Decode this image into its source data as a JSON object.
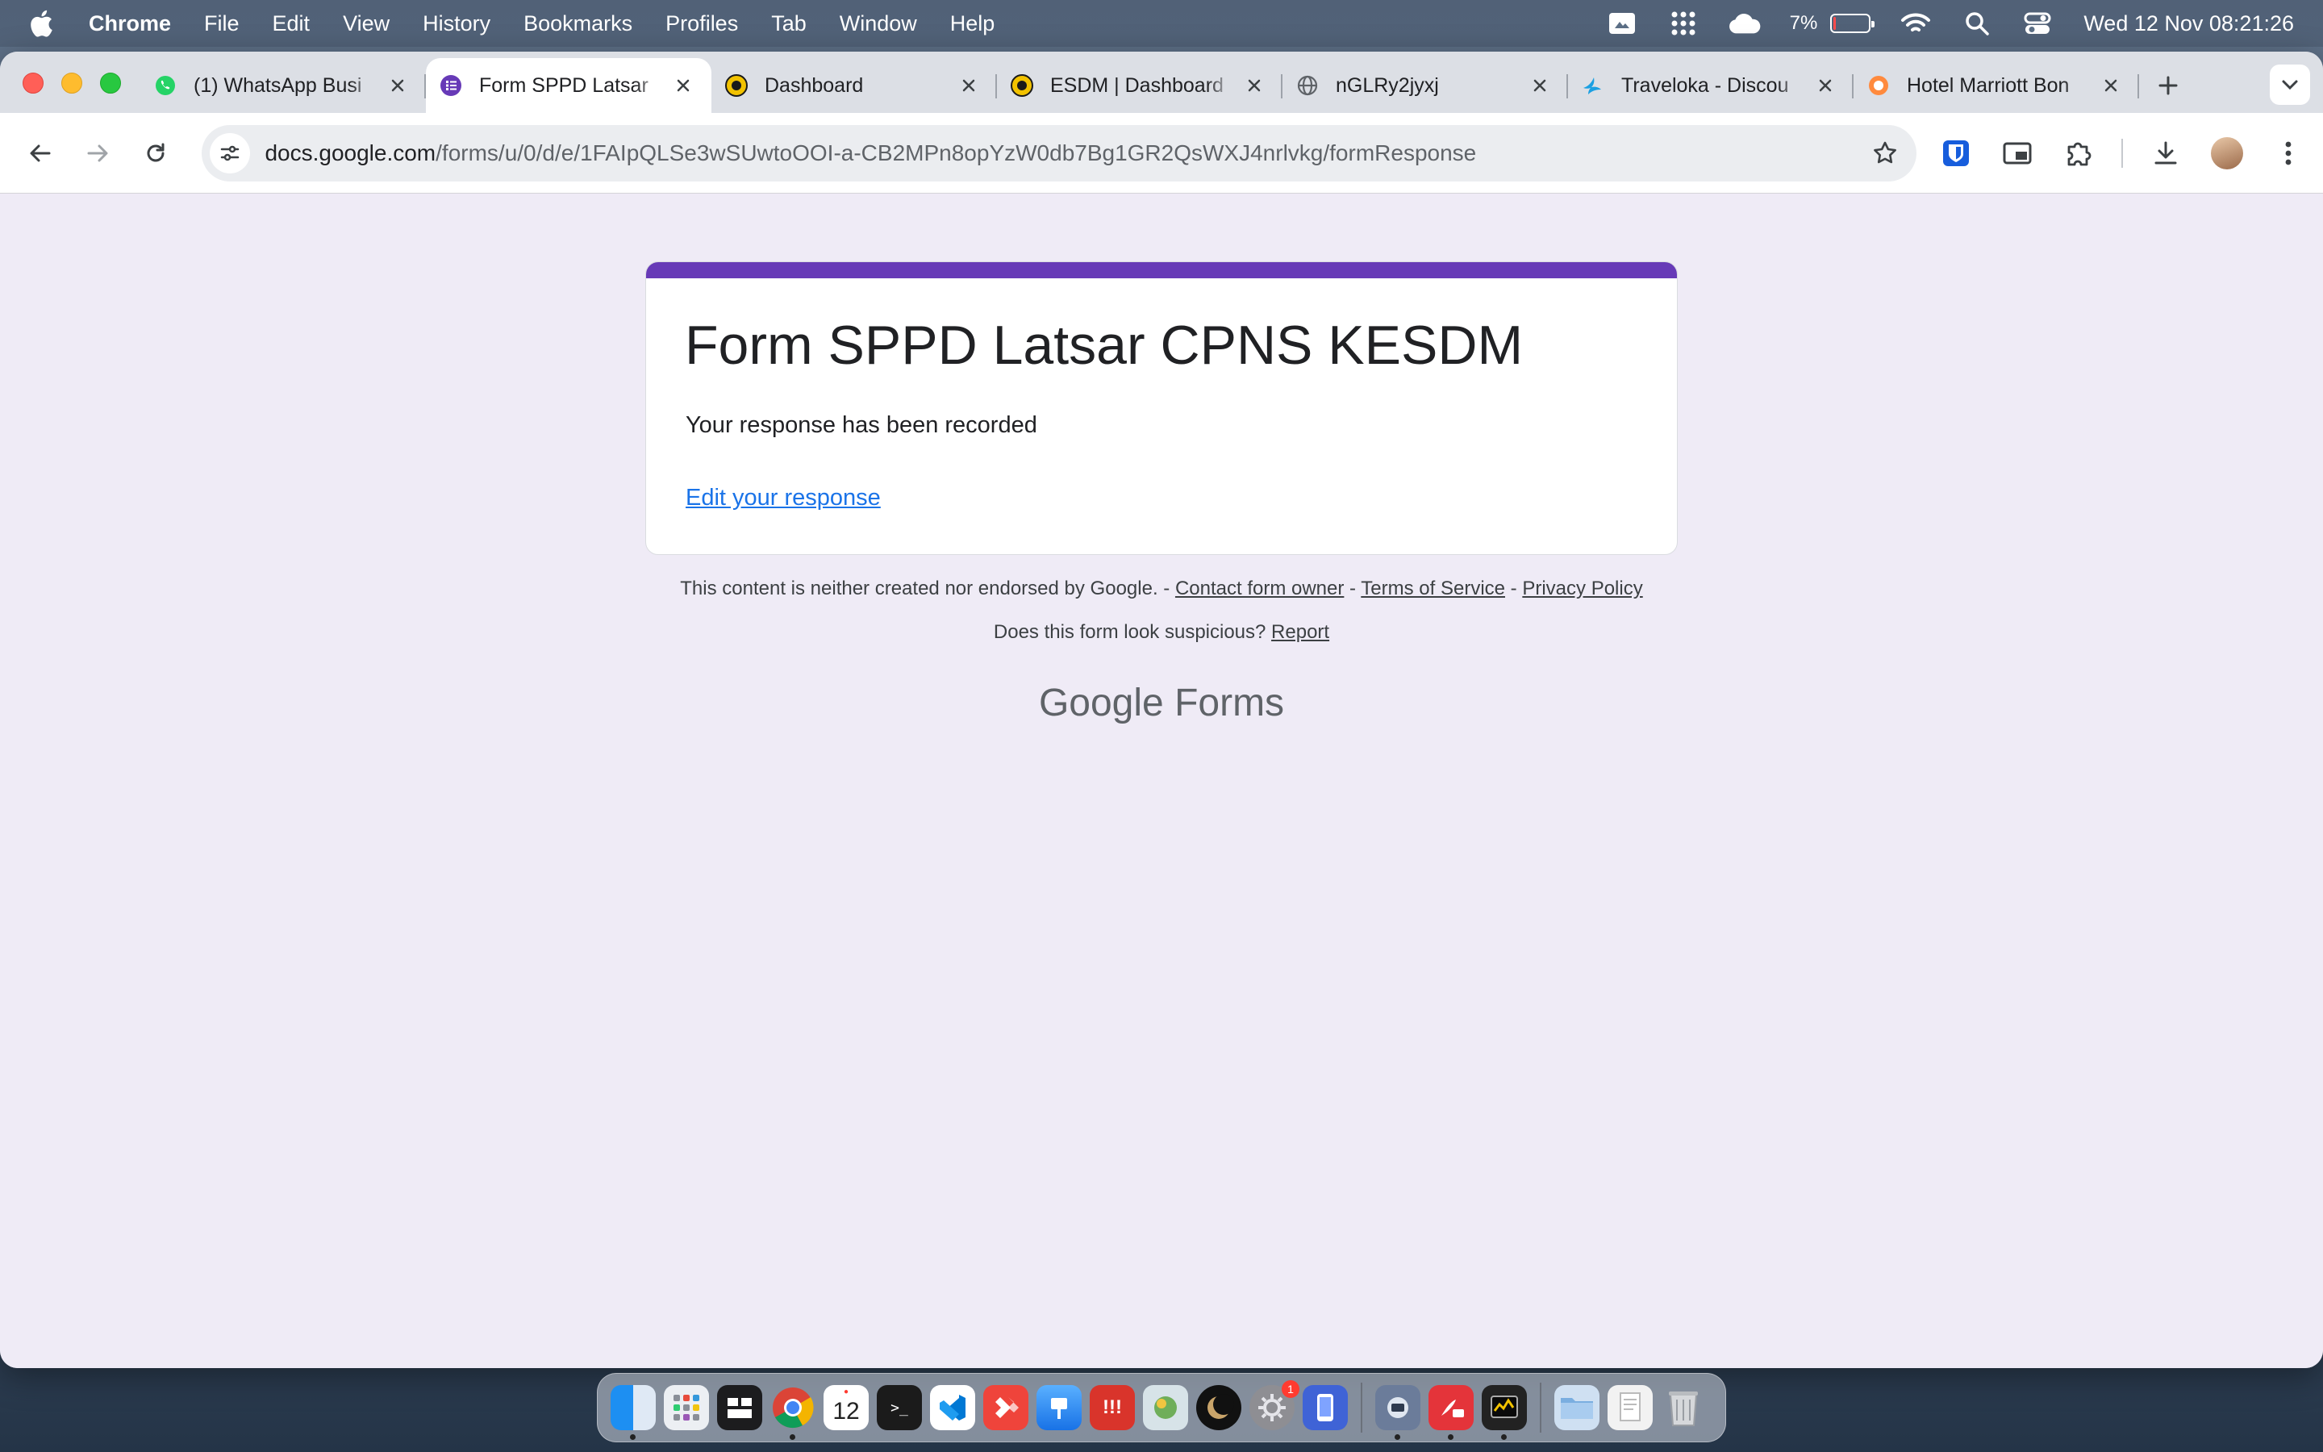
{
  "menubar": {
    "app_name": "Chrome",
    "items": [
      "File",
      "Edit",
      "View",
      "History",
      "Bookmarks",
      "Profiles",
      "Tab",
      "Window",
      "Help"
    ],
    "battery_percent": "7%",
    "battery_level": 0.07,
    "clock": "Wed 12 Nov  08:21:26"
  },
  "tabs": [
    {
      "title": "(1) WhatsApp Busi",
      "icon": "whatsapp-icon",
      "color": "#25d366"
    },
    {
      "title": "Form SPPD Latsar",
      "icon": "google-forms-icon",
      "color": "#673ab7"
    },
    {
      "title": "Dashboard",
      "icon": "esdm-logo-icon",
      "color": "#f2c200"
    },
    {
      "title": "ESDM | Dashboard",
      "icon": "esdm-logo-icon",
      "color": "#f2c200"
    },
    {
      "title": "nGLRy2jyxj",
      "icon": "globe-icon",
      "color": "#5f6368"
    },
    {
      "title": "Traveloka - Discou",
      "icon": "traveloka-icon",
      "color": "#1ba0e2"
    },
    {
      "title": "Hotel Marriott Bon",
      "icon": "marriott-icon",
      "color": "#ff8a3d"
    }
  ],
  "address_bar": {
    "url_host": "docs.google.com",
    "url_path": "/forms/u/0/d/e/1FAIpQLSe3wSUwtoOOI-a-CB2MPn8opYzW0db7Bg1GR2QsWXJ4nrlvkg/formResponse"
  },
  "form": {
    "title": "Form SPPD Latsar CPNS KESDM",
    "message": "Your response has been recorded",
    "edit_link": "Edit your response",
    "accent_color": "#673ab7"
  },
  "footer": {
    "disclaimer": "This content is neither created nor endorsed by Google. -",
    "contact_link": "Contact form owner",
    "sep1": "-",
    "terms_link": "Terms of Service",
    "sep2": "-",
    "privacy_link": "Privacy Policy",
    "suspicious_text": "Does this form look suspicious?",
    "report_link": "Report",
    "logo_google": "Google",
    "logo_forms": "Forms"
  },
  "dock": {
    "calendar_day": "12",
    "settings_badge": "1"
  }
}
